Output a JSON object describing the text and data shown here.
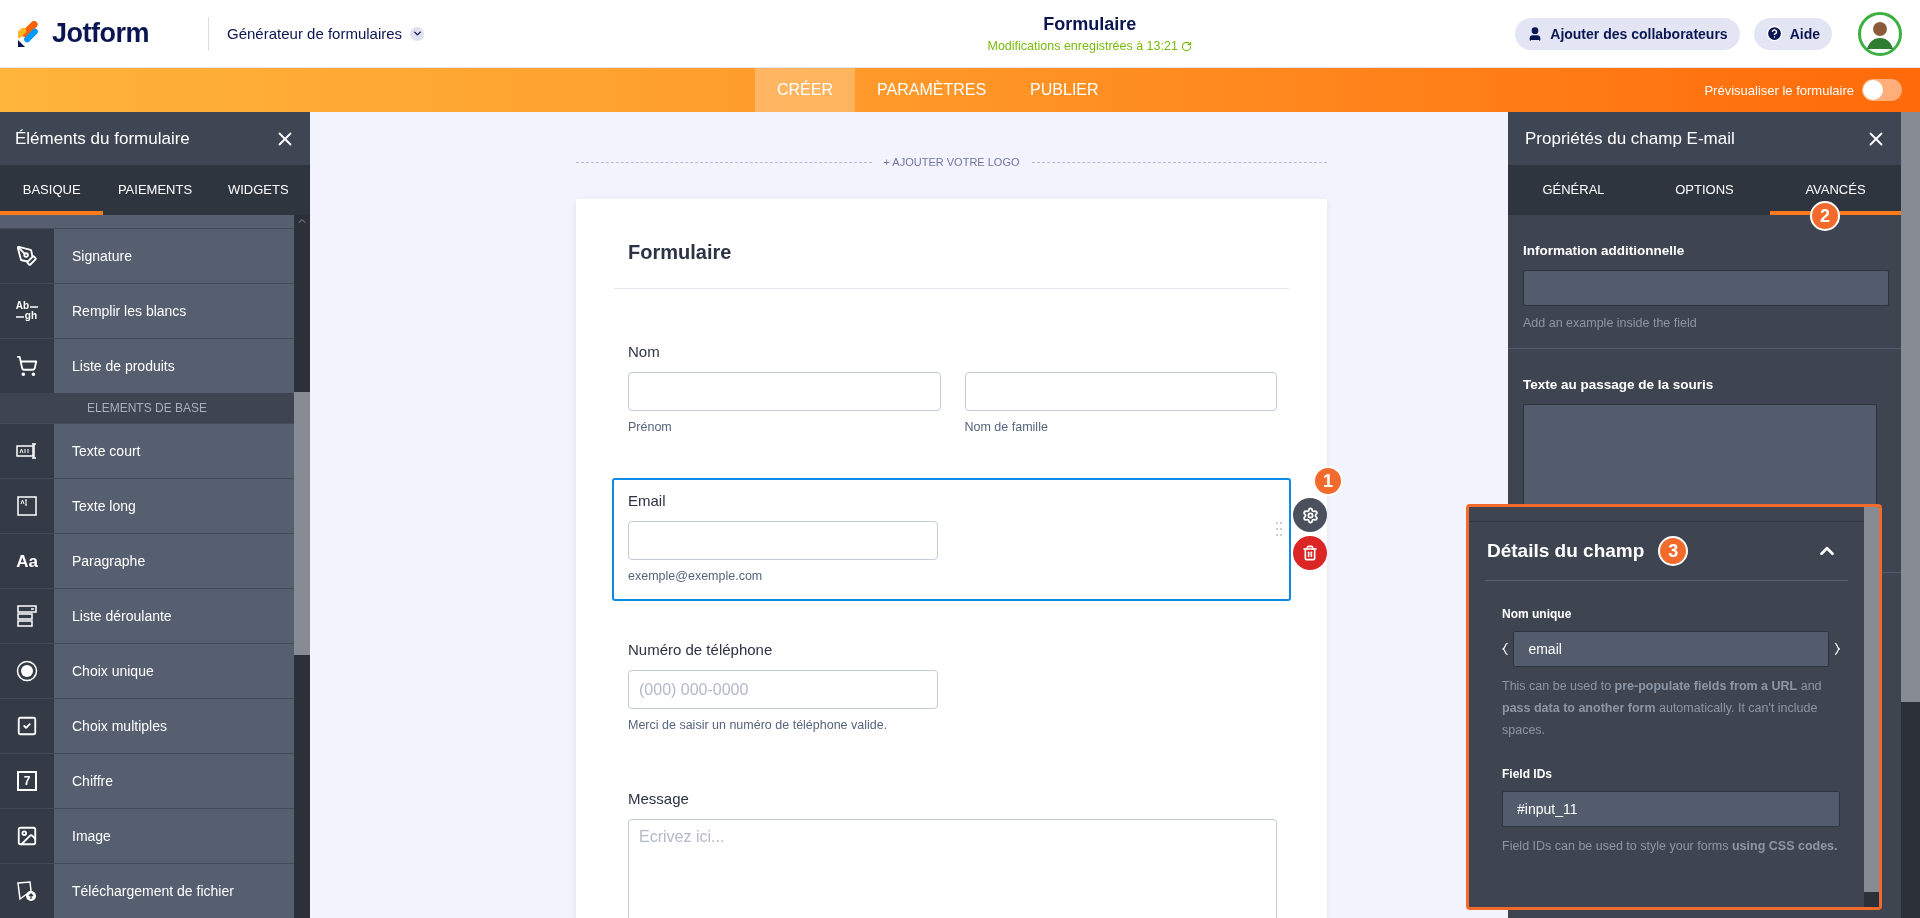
{
  "header": {
    "logo": "Jotform",
    "builder": "Générateur de formulaires",
    "title": "Formulaire",
    "saved": "Modifications enregistrées à 13:21",
    "buttons": [
      {
        "kind": "collaborators",
        "label": "Ajouter des collaborateurs"
      },
      {
        "kind": "help",
        "label": "Aide"
      }
    ]
  },
  "nav": {
    "tabs": [
      {
        "label": "CRÉER",
        "selected": true
      },
      {
        "label": "PARAMÈTRES",
        "selected": false
      },
      {
        "label": "PUBLIER",
        "selected": false
      }
    ],
    "preview": {
      "label": "Prévisualiser le formulaire",
      "on": false
    }
  },
  "elements_panel": {
    "title": "Éléments du formulaire",
    "tabs": [
      {
        "label": "BASIQUE",
        "selected": true
      },
      {
        "label": "PAIEMENTS",
        "selected": false
      },
      {
        "label": "WIDGETS",
        "selected": false
      }
    ],
    "items": [
      {
        "kind": "signature",
        "label": "Signature"
      },
      {
        "kind": "fill_blank",
        "label": "Remplir les blancs",
        "glyph": [
          "Ab",
          "gh"
        ]
      },
      {
        "kind": "cart",
        "label": "Liste de produits"
      },
      {
        "kind": "section",
        "label": "ELEMENTS DE BASE"
      },
      {
        "kind": "short_text",
        "label": "Texte court"
      },
      {
        "kind": "long_text",
        "label": "Texte long"
      },
      {
        "kind": "paragraph",
        "label": "Paragraphe",
        "glyph": [
          "Aa"
        ]
      },
      {
        "kind": "dropdown",
        "label": "Liste déroulante"
      },
      {
        "kind": "radio",
        "label": "Choix unique"
      },
      {
        "kind": "checkbox",
        "label": "Choix multiples"
      },
      {
        "kind": "number",
        "label": "Chiffre",
        "glyph": [
          "7"
        ]
      },
      {
        "kind": "image",
        "label": "Image"
      },
      {
        "kind": "upload",
        "label": "Téléchargement de fichier"
      }
    ]
  },
  "form": {
    "add_logo": "+ AJOUTER VOTRE LOGO",
    "title": "Formulaire",
    "fields": [
      {
        "kind": "name",
        "label": "Nom",
        "sublabels": [
          "Prénom",
          "Nom de famille"
        ],
        "selected": false
      },
      {
        "kind": "email",
        "label": "Email",
        "sublabel": "exemple@exemple.com",
        "selected": true,
        "badge": "1"
      },
      {
        "kind": "phone",
        "label": "Numéro de téléphone",
        "placeholder": "(000) 000-0000",
        "sublabel": "Merci de saisir un numéro de téléphone valide.",
        "selected": false
      },
      {
        "kind": "textarea",
        "label": "Message",
        "placeholder": "Ecrivez ici...",
        "selected": false
      }
    ]
  },
  "properties_panel": {
    "title": "Propriétés du champ E-mail",
    "tabs": [
      {
        "label": "GÉNÉRAL",
        "selected": false
      },
      {
        "label": "OPTIONS",
        "selected": false
      },
      {
        "label": "AVANCÉS",
        "selected": true,
        "badge": "2"
      }
    ],
    "sections": [
      {
        "kind": "input",
        "label": "Information additionnelle",
        "hint": "Add an example inside the field"
      },
      {
        "kind": "textarea",
        "label": "Texte au passage de la souris"
      }
    ]
  },
  "details": {
    "title": "Détails du champ",
    "badge": "3",
    "expanded": true,
    "groups": [
      {
        "kind": "braced",
        "label": "Nom unique",
        "value": "email",
        "help": "This can be used to **pre-populate fields from a URL** and **pass data to another form** automatically. It can't include spaces."
      },
      {
        "kind": "plain",
        "label": "Field IDs",
        "value": "#input_11",
        "help": "Field IDs can be used to style your forms **using CSS codes.**"
      }
    ]
  }
}
